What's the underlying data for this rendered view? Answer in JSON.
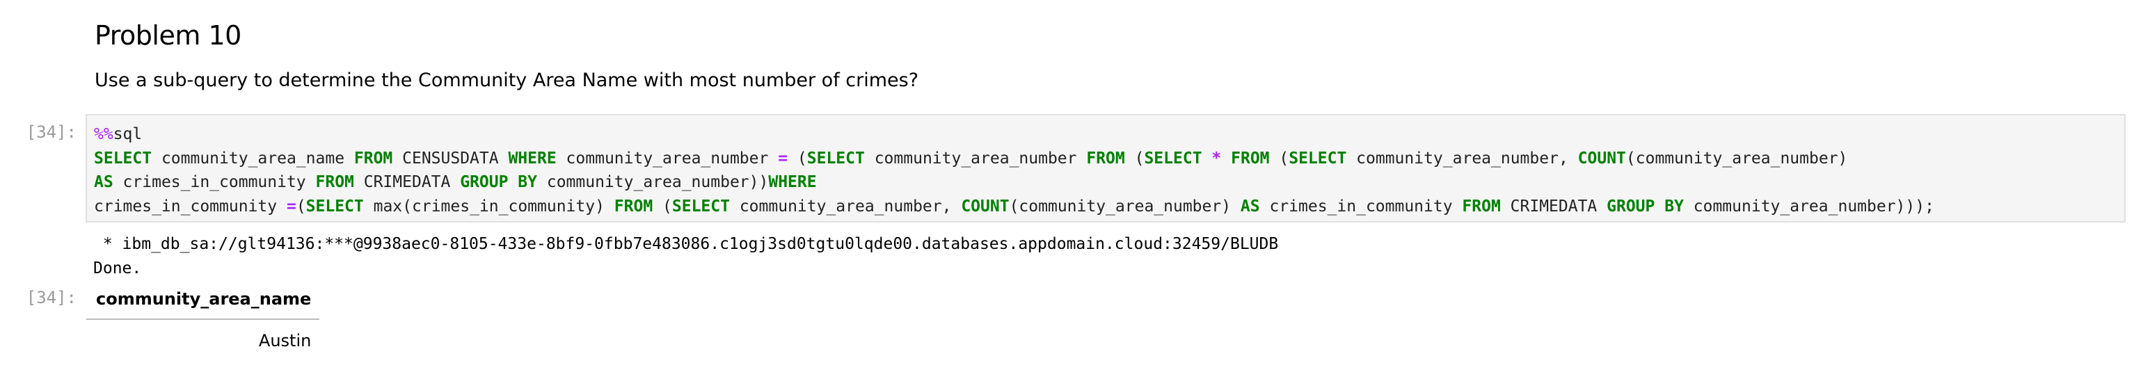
{
  "markdown": {
    "heading": "Problem 10",
    "question": "Use a sub-query to determine the Community Area Name with most number of crimes?"
  },
  "cell": {
    "input_prompt": "[34]:",
    "output_prompt": "[34]:",
    "code_lines": [
      [
        {
          "t": "%%",
          "c": "mg"
        },
        {
          "t": "sql",
          "c": "pn"
        }
      ],
      [
        {
          "t": "SELECT",
          "c": "kw"
        },
        {
          "t": " community_area_name ",
          "c": "pn"
        },
        {
          "t": "FROM",
          "c": "kw"
        },
        {
          "t": " CENSUSDATA ",
          "c": "pn"
        },
        {
          "t": "WHERE",
          "c": "kw"
        },
        {
          "t": " community_area_number ",
          "c": "pn"
        },
        {
          "t": "=",
          "c": "op"
        },
        {
          "t": " (",
          "c": "pn"
        },
        {
          "t": "SELECT",
          "c": "kw"
        },
        {
          "t": " community_area_number ",
          "c": "pn"
        },
        {
          "t": "FROM",
          "c": "kw"
        },
        {
          "t": " (",
          "c": "pn"
        },
        {
          "t": "SELECT",
          "c": "kw"
        },
        {
          "t": " ",
          "c": "pn"
        },
        {
          "t": "*",
          "c": "op"
        },
        {
          "t": " ",
          "c": "pn"
        },
        {
          "t": "FROM",
          "c": "kw"
        },
        {
          "t": " (",
          "c": "pn"
        },
        {
          "t": "SELECT",
          "c": "kw"
        },
        {
          "t": " community_area_number, ",
          "c": "pn"
        },
        {
          "t": "COUNT",
          "c": "kw"
        },
        {
          "t": "(community_area_number)",
          "c": "pn"
        }
      ],
      [
        {
          "t": "AS",
          "c": "kw"
        },
        {
          "t": " crimes_in_community ",
          "c": "pn"
        },
        {
          "t": "FROM",
          "c": "kw"
        },
        {
          "t": " CRIMEDATA ",
          "c": "pn"
        },
        {
          "t": "GROUP BY",
          "c": "kw"
        },
        {
          "t": " community_area_number))",
          "c": "pn"
        },
        {
          "t": "WHERE",
          "c": "kw"
        }
      ],
      [
        {
          "t": "crimes_in_community ",
          "c": "pn"
        },
        {
          "t": "=",
          "c": "op"
        },
        {
          "t": "(",
          "c": "pn"
        },
        {
          "t": "SELECT",
          "c": "kw"
        },
        {
          "t": " max(crimes_in_community) ",
          "c": "pn"
        },
        {
          "t": "FROM",
          "c": "kw"
        },
        {
          "t": " (",
          "c": "pn"
        },
        {
          "t": "SELECT",
          "c": "kw"
        },
        {
          "t": " community_area_number, ",
          "c": "pn"
        },
        {
          "t": "COUNT",
          "c": "kw"
        },
        {
          "t": "(community_area_number) ",
          "c": "pn"
        },
        {
          "t": "AS",
          "c": "kw"
        },
        {
          "t": " crimes_in_community ",
          "c": "pn"
        },
        {
          "t": "FROM",
          "c": "kw"
        },
        {
          "t": " CRIMEDATA ",
          "c": "pn"
        },
        {
          "t": "GROUP BY",
          "c": "kw"
        },
        {
          "t": " community_area_number)));",
          "c": "pn"
        }
      ]
    ],
    "output_lines": [
      " * ibm_db_sa://glt94136:***@9938aec0-8105-433e-8bf9-0fbb7e483086.c1ogj3sd0tgtu0lqde00.databases.appdomain.cloud:32459/BLUDB",
      "Done."
    ],
    "result": {
      "header": "community_area_name",
      "rows": [
        "Austin"
      ]
    }
  },
  "colors": {
    "keyword": "#008000",
    "magic": "#aa22ff",
    "prompt": "#9a9a9a",
    "cell_background": "#f5f5f5"
  }
}
